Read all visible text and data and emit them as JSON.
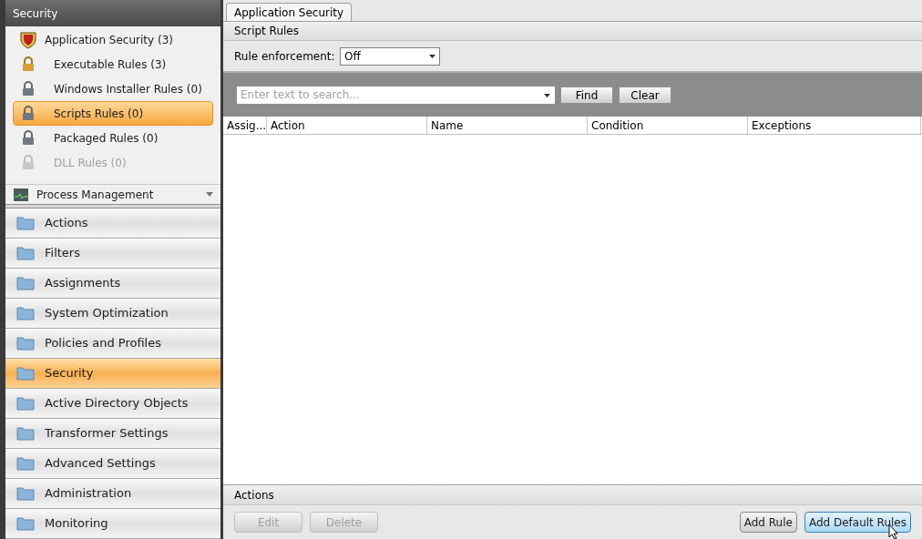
{
  "sidebar": {
    "header": "Security",
    "tree": [
      {
        "label": "Application Security (3)",
        "kind": "shield",
        "selected": false,
        "disabled": false,
        "children": [
          {
            "label": "Executable Rules (3)",
            "kind": "lock-gold",
            "selected": false,
            "disabled": false
          },
          {
            "label": "Windows Installer Rules (0)",
            "kind": "lock",
            "selected": false,
            "disabled": false
          },
          {
            "label": "Scripts Rules (0)",
            "kind": "lock",
            "selected": true,
            "disabled": false
          },
          {
            "label": "Packaged Rules (0)",
            "kind": "lock",
            "selected": false,
            "disabled": false
          },
          {
            "label": "DLL Rules (0)",
            "kind": "lock",
            "selected": false,
            "disabled": true
          }
        ]
      }
    ],
    "section": {
      "label": "Process Management"
    },
    "nav": [
      {
        "label": "Actions",
        "selected": false
      },
      {
        "label": "Filters",
        "selected": false
      },
      {
        "label": "Assignments",
        "selected": false
      },
      {
        "label": "System Optimization",
        "selected": false
      },
      {
        "label": "Policies and Profiles",
        "selected": false
      },
      {
        "label": "Security",
        "selected": true
      },
      {
        "label": "Active Directory Objects",
        "selected": false
      },
      {
        "label": "Transformer Settings",
        "selected": false
      },
      {
        "label": "Advanced Settings",
        "selected": false
      },
      {
        "label": "Administration",
        "selected": false
      },
      {
        "label": "Monitoring",
        "selected": false
      }
    ]
  },
  "tabs": [
    {
      "label": "Application Security",
      "selected": true
    }
  ],
  "panel_title": "Script Rules",
  "enforcement": {
    "label": "Rule enforcement:",
    "value": "Off"
  },
  "search": {
    "placeholder": "Enter text to search...",
    "buttons": [
      "Find",
      "Clear"
    ]
  },
  "table": {
    "columns": [
      "Assig...",
      "Action",
      "Name",
      "Condition",
      "Exceptions"
    ]
  },
  "actions": {
    "title": "Actions",
    "buttons": [
      {
        "label": "Edit",
        "disabled": true,
        "highlighted": false
      },
      {
        "label": "Delete",
        "disabled": true,
        "highlighted": false
      },
      {
        "label": "Add Rule",
        "disabled": false,
        "highlighted": false
      },
      {
        "label": "Add Default Rules",
        "disabled": false,
        "highlighted": true
      }
    ]
  }
}
